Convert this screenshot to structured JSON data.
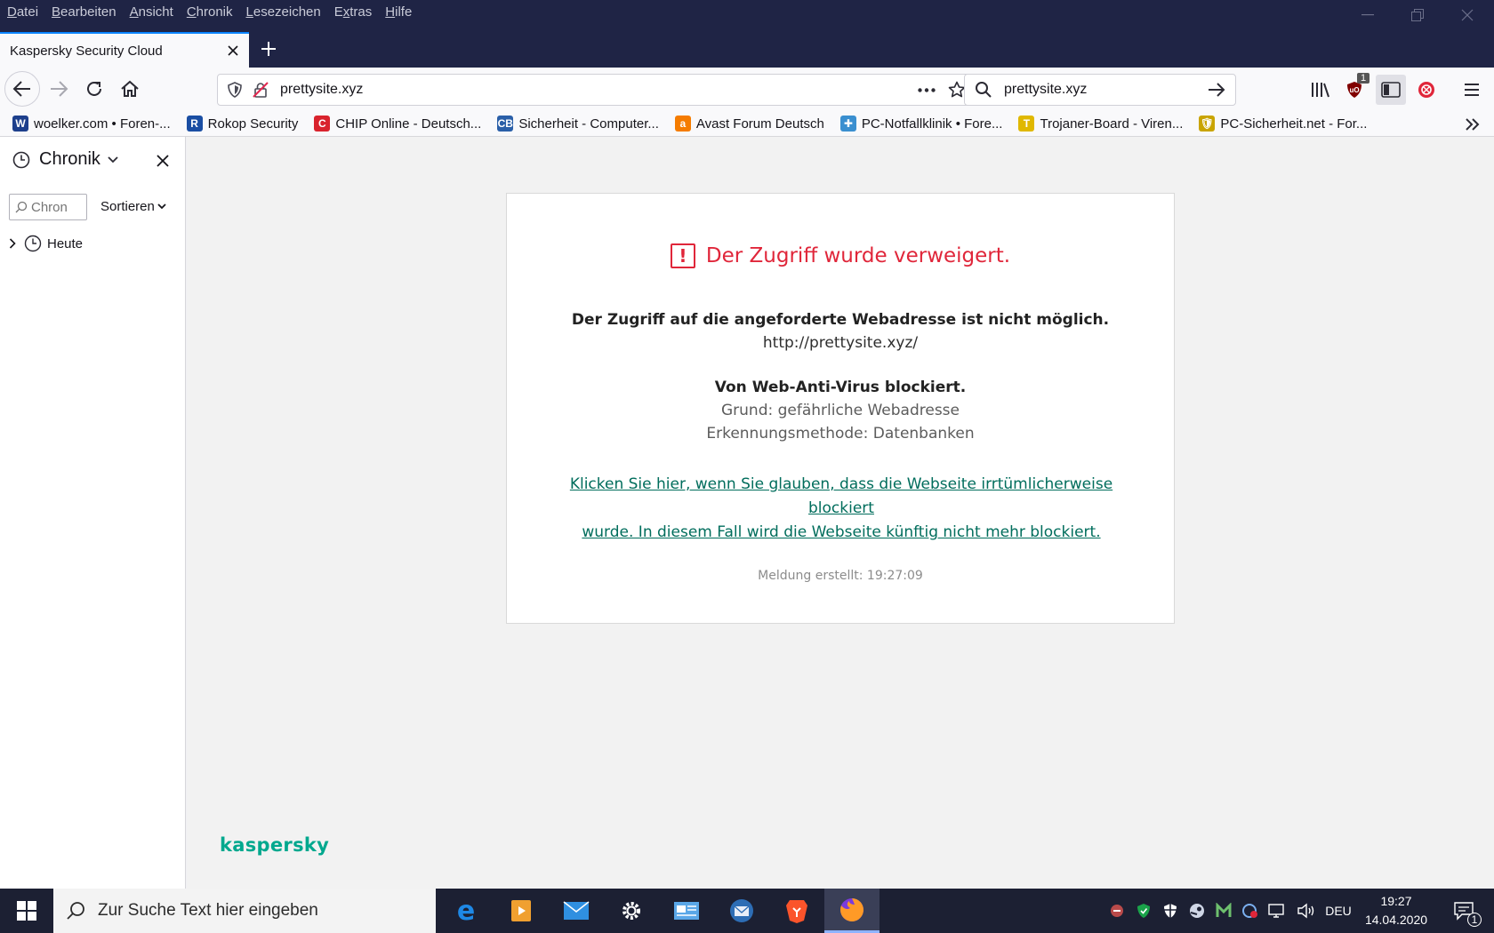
{
  "menu": [
    "Datei",
    "Bearbeiten",
    "Ansicht",
    "Chronik",
    "Lesezeichen",
    "Extras",
    "Hilfe"
  ],
  "menu_access_keys": [
    "D",
    "B",
    "A",
    "C",
    "L",
    "x",
    "H"
  ],
  "tab": {
    "title": "Kaspersky Security Cloud"
  },
  "urlbar": {
    "url": "prettysite.xyz"
  },
  "searchbar": {
    "value": "prettysite.xyz"
  },
  "ublock_badge": "1",
  "bookmarks": [
    {
      "label": "woelker.com • Foren-...",
      "icon": "W",
      "color": "#1d3f8c"
    },
    {
      "label": "Rokop Security",
      "icon": "R",
      "color": "#1a4ea3"
    },
    {
      "label": "CHIP Online - Deutsch...",
      "icon": "C",
      "color": "#d9232d"
    },
    {
      "label": "Sicherheit - Computer...",
      "icon": "CB",
      "color": "#2a5fa8"
    },
    {
      "label": "Avast Forum Deutsch",
      "icon": "a",
      "color": "#f57c00"
    },
    {
      "label": "PC-Notfallklinik • Fore...",
      "icon": "✚",
      "color": "#3a8fd0"
    },
    {
      "label": "Trojaner-Board - Viren...",
      "icon": "T",
      "color": "#e0b800"
    },
    {
      "label": "PC-Sicherheit.net - For...",
      "icon": "🛡",
      "color": "#c9a400"
    }
  ],
  "sidebar": {
    "title": "Chronik",
    "search_placeholder": "Chron",
    "sort_label": "Sortieren",
    "tree_item": "Heute"
  },
  "page": {
    "title": "Der Zugriff wurde verweigert.",
    "line1": "Der Zugriff auf die angeforderte Webadresse ist nicht möglich.",
    "url": "http://prettysite.xyz/",
    "blocked_by": "Von Web-Anti-Virus blockiert.",
    "reason": "Grund: gefährliche Webadresse",
    "method": "Erkennungsmethode: Datenbanken",
    "link_line1": "Klicken Sie hier, wenn Sie glauben, dass die Webseite irrtümlicherweise blockiert",
    "link_line2": "wurde. In diesem Fall wird die Webseite künftig nicht mehr blockiert.",
    "timestamp": "Meldung erstellt: 19:27:09",
    "brand": "kaspersky"
  },
  "taskbar": {
    "search_placeholder": "Zur Suche Text hier eingeben",
    "language": "DEU",
    "time": "19:27",
    "date": "14.04.2020",
    "notification_count": "1"
  },
  "colors": {
    "accent": "#0a84ff",
    "error_red": "#e0263a",
    "link_green": "#006d5c",
    "brand_green": "#00a88e",
    "titlebar": "#1f2445",
    "taskbar": "#1c2033"
  }
}
